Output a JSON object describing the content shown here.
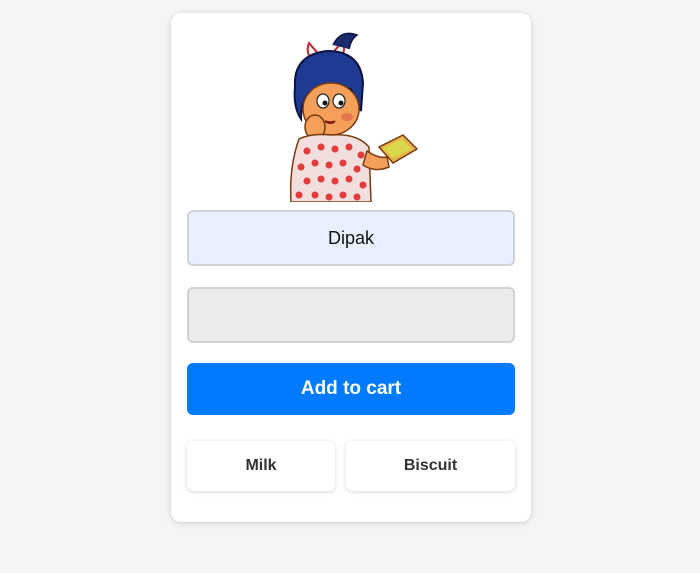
{
  "form": {
    "name_value": "Dipak",
    "second_value": "",
    "add_button_label": "Add to cart"
  },
  "suggestions": [
    {
      "label": "Milk"
    },
    {
      "label": "Biscuit"
    }
  ],
  "colors": {
    "accent": "#007bff",
    "name_field_bg": "#e8f0fe",
    "empty_field_bg": "#ececec"
  },
  "mascot": {
    "icon": "mascot-girl-eating-toast-icon"
  }
}
